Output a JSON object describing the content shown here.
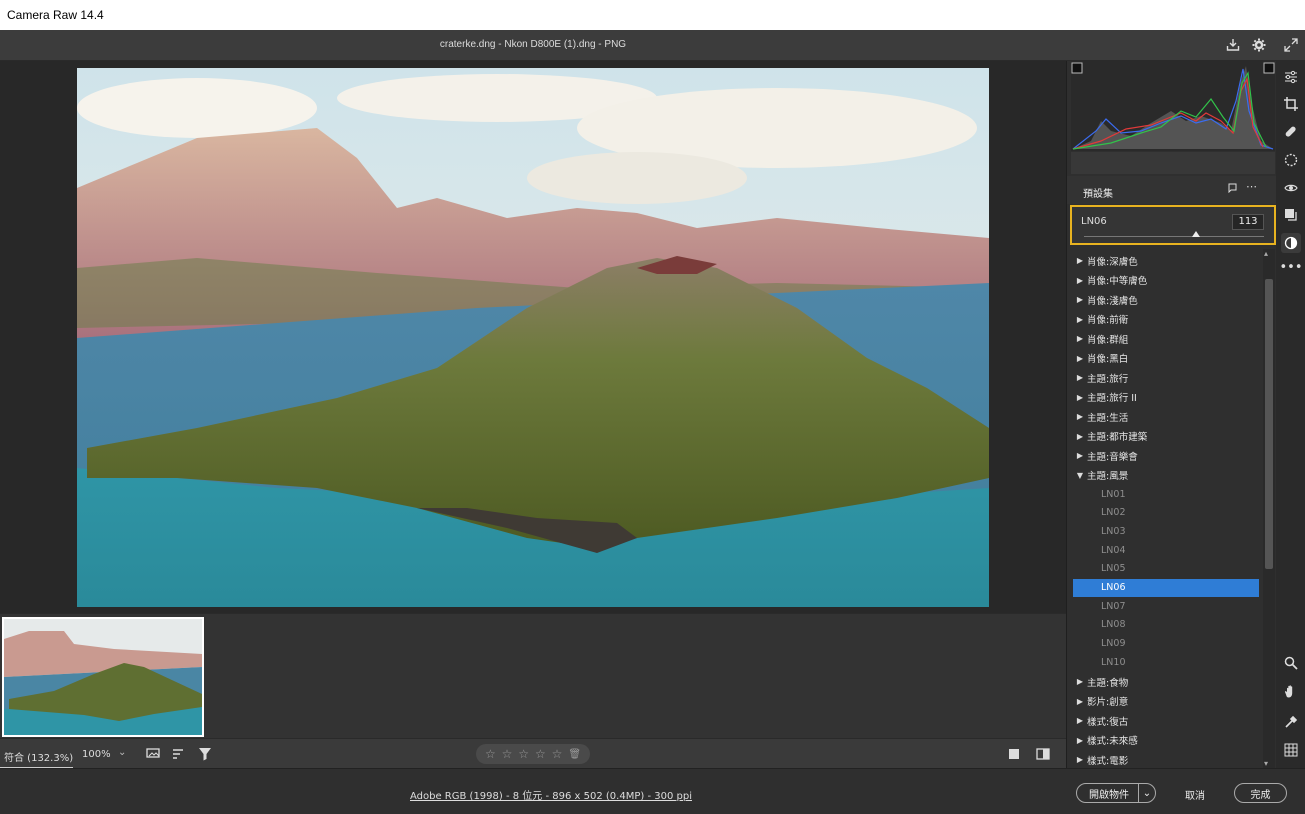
{
  "app": {
    "title": "Camera Raw 14.4"
  },
  "header": {
    "file_info": "craterke.dng - Nkon D800E (1).dng  -  PNG"
  },
  "icons": {
    "save": "download-icon",
    "settings": "gear-icon",
    "fullscreen": "expand-icon",
    "edit": "sliders-icon",
    "crop": "crop-icon",
    "heal": "bandage-icon",
    "mask": "mask-icon",
    "redeye": "red-eye-icon",
    "snapshots": "snapshots-icon",
    "presets": "presets-icon",
    "more": "more-icon",
    "zoom": "magnifier-icon",
    "hand": "hand-icon",
    "sampler": "eyedropper-icon",
    "grid": "grid-icon"
  },
  "status": {
    "zoom_fit": "符合 (132.3%)",
    "zoom_percent": "100%",
    "rating_stars": 5
  },
  "footer": {
    "info": "Adobe RGB (1998) - 8 位元 - 896 x 502 (0.4MP) - 300 ppi",
    "open_label": "開啟物件",
    "cancel_label": "取消",
    "done_label": "完成"
  },
  "presets": {
    "title": "預設集",
    "amount": {
      "name": "LN06",
      "value": "113",
      "fraction": 0.62
    },
    "groups": [
      {
        "label": "肖像:深膚色",
        "expanded": false
      },
      {
        "label": "肖像:中等膚色",
        "expanded": false
      },
      {
        "label": "肖像:淺膚色",
        "expanded": false
      },
      {
        "label": "肖像:前衛",
        "expanded": false
      },
      {
        "label": "肖像:群組",
        "expanded": false
      },
      {
        "label": "肖像:黑白",
        "expanded": false
      },
      {
        "label": "主題:旅行",
        "expanded": false
      },
      {
        "label": "主題:旅行 II",
        "expanded": false
      },
      {
        "label": "主題:生活",
        "expanded": false
      },
      {
        "label": "主題:都市建築",
        "expanded": false
      },
      {
        "label": "主題:音樂會",
        "expanded": false
      },
      {
        "label": "主題:風景",
        "expanded": true
      }
    ],
    "items": [
      "LN01",
      "LN02",
      "LN03",
      "LN04",
      "LN05",
      "LN06",
      "LN07",
      "LN08",
      "LN09",
      "LN10"
    ],
    "selected_item": "LN06",
    "groups_after": [
      {
        "label": "主題:食物"
      },
      {
        "label": "影片:創意"
      },
      {
        "label": "樣式:復古"
      },
      {
        "label": "樣式:未來感"
      },
      {
        "label": "樣式:電影"
      }
    ]
  },
  "colors": {
    "accent": "#2f7dd6",
    "highlight_border": "#e8b320"
  }
}
